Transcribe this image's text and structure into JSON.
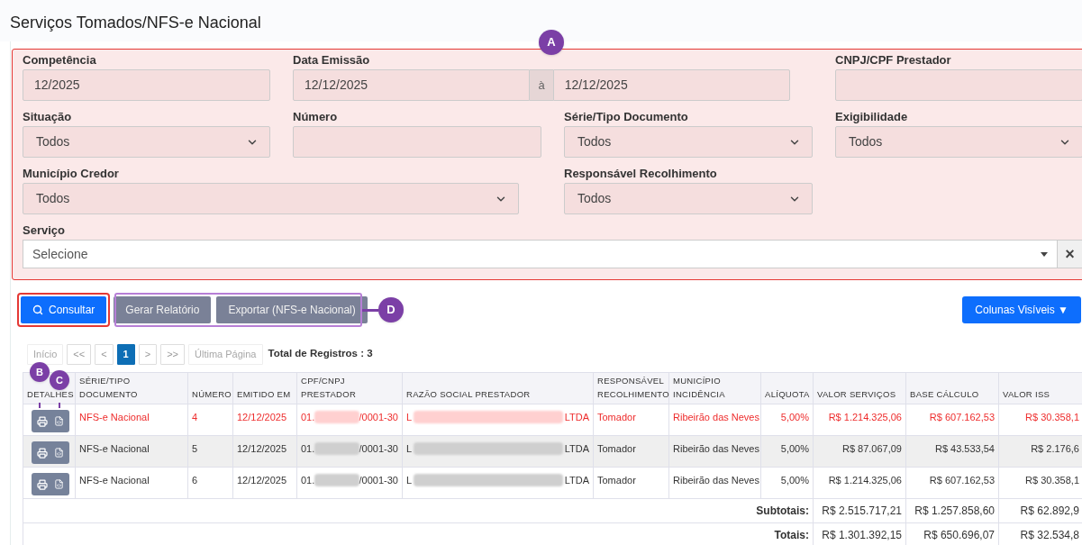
{
  "title": "Serviços Tomados/NFS-e Nacional",
  "filters": {
    "badge": "A",
    "rows": [
      [
        {
          "kind": "text",
          "label": "Competência",
          "value": "12/2025"
        },
        {
          "kind": "range",
          "label": "Data Emissão",
          "from": "12/12/2025",
          "separator": "à",
          "to": "12/12/2025"
        },
        "",
        {
          "kind": "text",
          "label": "CNPJ/CPF Prestador"
        }
      ],
      [
        {
          "kind": "select",
          "label": "Situação",
          "value": "Todos"
        },
        {
          "kind": "text",
          "label": "Número"
        },
        {
          "kind": "select",
          "label": "Série/Tipo Documento",
          "value": "Todos"
        },
        {
          "kind": "select",
          "label": "Exigibilidade",
          "value": "Todos"
        }
      ],
      [
        {
          "kind": "select-wide",
          "label": "Município Credor",
          "value": "Todos"
        },
        "",
        {
          "kind": "select",
          "label": "Responsável Recolhimento",
          "value": "Todos"
        }
      ],
      [
        {
          "kind": "search-select",
          "label": "Serviço",
          "placeholder": "Selecione",
          "clear": "×"
        }
      ]
    ]
  },
  "actions": [
    {
      "kind": "primary",
      "label": "Consultar",
      "outlined": true
    },
    {
      "kind": "secondary",
      "label": "Gerar Relatório",
      "outlined": false
    },
    {
      "kind": "secondary",
      "label": "Exportar (NFS-e Nacional)",
      "outlined": false
    }
  ],
  "actions_badge": "D",
  "columns_button": "Colunas Visíveis ▼",
  "pagination": {
    "pages": [
      {
        "label": "Início",
        "disabled": true,
        "selected": false
      },
      {
        "label": "<<",
        "disabled": false,
        "selected": false
      },
      {
        "label": "<",
        "disabled": false,
        "selected": false
      },
      {
        "label": "1",
        "disabled": false,
        "selected": true
      },
      {
        "label": ">",
        "disabled": false,
        "selected": false
      },
      {
        "label": ">>",
        "disabled": false,
        "selected": false
      },
      {
        "label": "Última Página",
        "disabled": true,
        "selected": false
      }
    ],
    "total": "Total de Registros : 3"
  },
  "table": {
    "badges": [
      "B",
      "C"
    ],
    "columns": [
      "DETALHES",
      "SÉRIE/TIPO DOCUMENTO",
      "NÚMERO",
      "EMITIDO EM",
      "CPF/CNPJ PRESTADOR",
      "RAZÃO SOCIAL PRESTADOR",
      "RESPONSÁVEL RECOLHIMENTO",
      "MUNICÍPIO INCIDÊNCIA",
      "ALÍQUOTA",
      "VALOR SERVIÇOS",
      "BASE CÁLCULO",
      "VALOR ISS"
    ],
    "rows": [
      {
        "highlighted": true,
        "shaded": false,
        "serie": "NFS-e Nacional",
        "numero": "4",
        "emitido": "12/12/2025",
        "cpf_start": "01.",
        "cpf_end": "/0001-30",
        "razao_start": "L",
        "razao_end": "LTDA",
        "responsavel": "Tomador",
        "municipio": "Ribeirão das Neves",
        "aliquota": "5,00%",
        "valor": "R$ 1.214.325,06",
        "base": "R$ 607.162,53",
        "iss": "R$ 30.358,1"
      },
      {
        "highlighted": false,
        "shaded": true,
        "serie": "NFS-e Nacional",
        "numero": "5",
        "emitido": "12/12/2025",
        "cpf_start": "01.",
        "cpf_end": "/0001-30",
        "razao_start": "L",
        "razao_end": "LTDA",
        "responsavel": "Tomador",
        "municipio": "Ribeirão das Neves",
        "aliquota": "5,00%",
        "valor": "R$ 87.067,09",
        "base": "R$ 43.533,54",
        "iss": "R$ 2.176,6"
      },
      {
        "highlighted": false,
        "shaded": false,
        "serie": "NFS-e Nacional",
        "numero": "6",
        "emitido": "12/12/2025",
        "cpf_start": "01.",
        "cpf_end": "/0001-30",
        "razao_start": "L",
        "razao_end": "LTDA",
        "responsavel": "Tomador",
        "municipio": "Ribeirão das Neves",
        "aliquota": "5,00%",
        "valor": "R$ 1.214.325,06",
        "base": "R$ 607.162,53",
        "iss": "R$ 30.358,1"
      }
    ],
    "summaries": [
      {
        "label": "Subtotais:",
        "valor": "R$ 2.515.717,21",
        "base": "R$ 1.257.858,60",
        "iss": "R$ 62.892,9"
      },
      {
        "label": "Totais:",
        "valor": "R$ 1.301.392,15",
        "base": "R$ 650.696,07",
        "iss": "R$ 32.534,8"
      }
    ]
  }
}
